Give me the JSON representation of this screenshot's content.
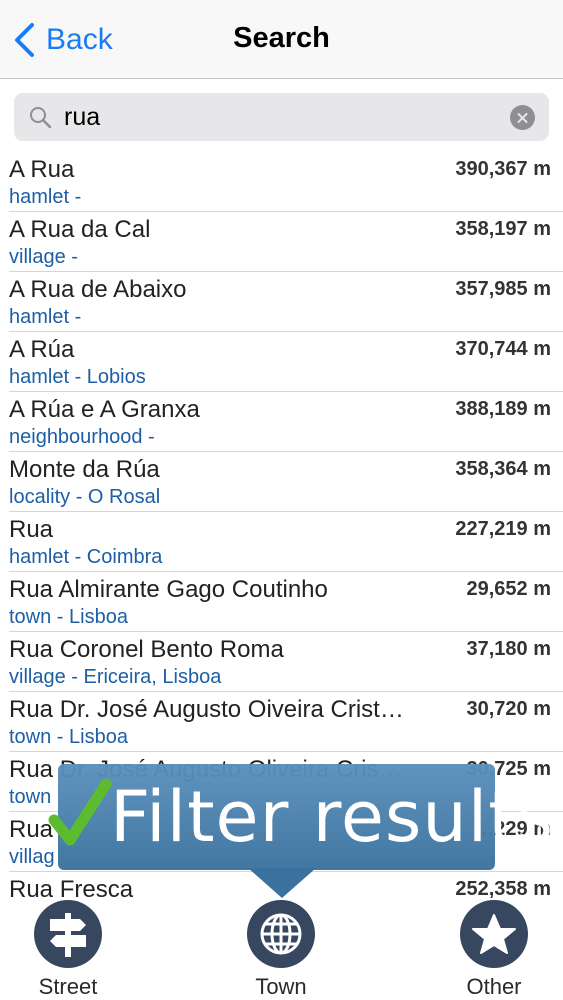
{
  "nav": {
    "back_label": "Back",
    "title": "Search"
  },
  "search": {
    "value": "rua"
  },
  "results": [
    {
      "name": "A Rua",
      "sub": "hamlet -",
      "dist": "390,367 m"
    },
    {
      "name": "A Rua da Cal",
      "sub": "village -",
      "dist": "358,197 m"
    },
    {
      "name": "A Rua de Abaixo",
      "sub": "hamlet -",
      "dist": "357,985 m"
    },
    {
      "name": "A Rúa",
      "sub": "hamlet - Lobios",
      "dist": "370,744 m"
    },
    {
      "name": "A Rúa e A Granxa",
      "sub": "neighbourhood -",
      "dist": "388,189 m"
    },
    {
      "name": "Monte da Rúa",
      "sub": "locality - O Rosal",
      "dist": "358,364 m"
    },
    {
      "name": "Rua",
      "sub": "hamlet - Coimbra",
      "dist": "227,219 m"
    },
    {
      "name": "Rua Almirante Gago Coutinho",
      "sub": "town - Lisboa",
      "dist": "29,652 m"
    },
    {
      "name": "Rua Coronel Bento Roma",
      "sub": "village - Ericeira, Lisboa",
      "dist": "37,180 m"
    },
    {
      "name": "Rua Dr. José Augusto Oiveira Crist…",
      "sub": "town - Lisboa",
      "dist": "30,720 m"
    },
    {
      "name": "Rua Dr. José Augusto Oliveira Cris…",
      "sub": "town",
      "dist": "30,725 m"
    },
    {
      "name": "Rua",
      "sub": "villag",
      "dist": "…229 m"
    },
    {
      "name": "Rua Fresca",
      "sub": "",
      "dist": "252,358 m"
    }
  ],
  "overlay": {
    "text": "Filter results"
  },
  "tabs": {
    "street": "Street",
    "town": "Town",
    "other": "Other"
  },
  "colors": {
    "accent": "#1a7cf5",
    "subtitle": "#1d5fa6",
    "tab_icon_bg": "#36475f",
    "overlay_bg": "#3f7aa8",
    "check": "#5dbb2f"
  }
}
